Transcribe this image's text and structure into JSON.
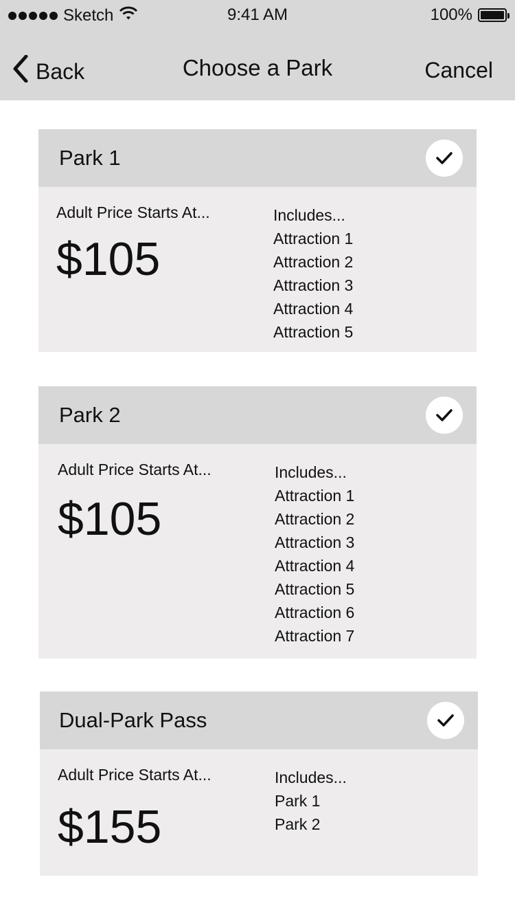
{
  "status_bar": {
    "carrier": "Sketch",
    "time": "9:41 AM",
    "battery": "100%"
  },
  "nav": {
    "back_label": "Back",
    "title": "Choose a Park",
    "cancel_label": "Cancel"
  },
  "cards": [
    {
      "title": "Park 1",
      "price_label": "Adult Price Starts At...",
      "price": "$105",
      "includes_label": "Includes...",
      "includes": [
        "Attraction 1",
        "Attraction 2",
        "Attraction 3",
        "Attraction 4",
        "Attraction 5"
      ]
    },
    {
      "title": "Park 2",
      "price_label": "Adult Price Starts At...",
      "price": "$105",
      "includes_label": "Includes...",
      "includes": [
        "Attraction 1",
        "Attraction 2",
        "Attraction 3",
        "Attraction 4",
        "Attraction 5",
        "Attraction 6",
        "Attraction 7"
      ]
    },
    {
      "title": "Dual-Park Pass",
      "price_label": "Adult Price Starts At...",
      "price": "$155",
      "includes_label": "Includes...",
      "includes": [
        "Park 1",
        "Park 2"
      ]
    }
  ]
}
